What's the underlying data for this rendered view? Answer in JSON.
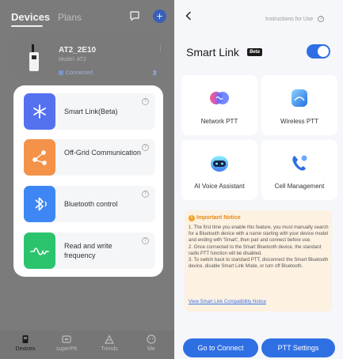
{
  "left": {
    "tabs": {
      "devices": "Devices",
      "plans": "Plans"
    },
    "device": {
      "name": "AT2_2E10",
      "model": "Model: AT2",
      "status": "Connected"
    },
    "menu": [
      {
        "label": "Smart Link(Beta)",
        "color": "#5471f0"
      },
      {
        "label": "Off-Grid Communication",
        "color": "#f4924a"
      },
      {
        "label": "Bluetooth control",
        "color": "#3e86f4"
      },
      {
        "label": "Read and write frequency",
        "color": "#2bc46d"
      }
    ],
    "tabbar": [
      {
        "label": "Devices",
        "active": true
      },
      {
        "label": "superPtt",
        "active": false
      },
      {
        "label": "Trends",
        "active": false
      },
      {
        "label": "Me",
        "active": false
      }
    ]
  },
  "right": {
    "instructions": "Instructions for Use",
    "title": "Smart Link",
    "beta_badge": "Beta",
    "toggle_on": true,
    "features": [
      {
        "label": "Network PTT",
        "icon": "network-ptt-icon"
      },
      {
        "label": "Wireless PTT",
        "icon": "wireless-ptt-icon"
      },
      {
        "label": "AI Voice Assistant",
        "icon": "ai-assistant-icon"
      },
      {
        "label": "Cell Management",
        "icon": "cell-management-icon"
      }
    ],
    "notice": {
      "title": "Important Notice",
      "body": "1. The first time you enable this feature, you must manually search for a Bluetooth device with a name starting with your device model and ending with 'Smart', then pair and connect before use.\n2. Once connected to the Smart Bluetooth device, the standard radio PTT function will be disabled.\n3. To switch back to standard PTT, disconnect the Smart Bluetooth device, disable Smart Link Mode, or turn off Bluetooth.",
      "link": "View Smart Link Compatibility Notice"
    },
    "buttons": {
      "connect": "Go to Connect",
      "settings": "PTT Settings"
    }
  },
  "colors": {
    "accent": "#2f6fe4",
    "notice_bg": "#fdf1e1",
    "notice_title": "#e58a1a"
  }
}
